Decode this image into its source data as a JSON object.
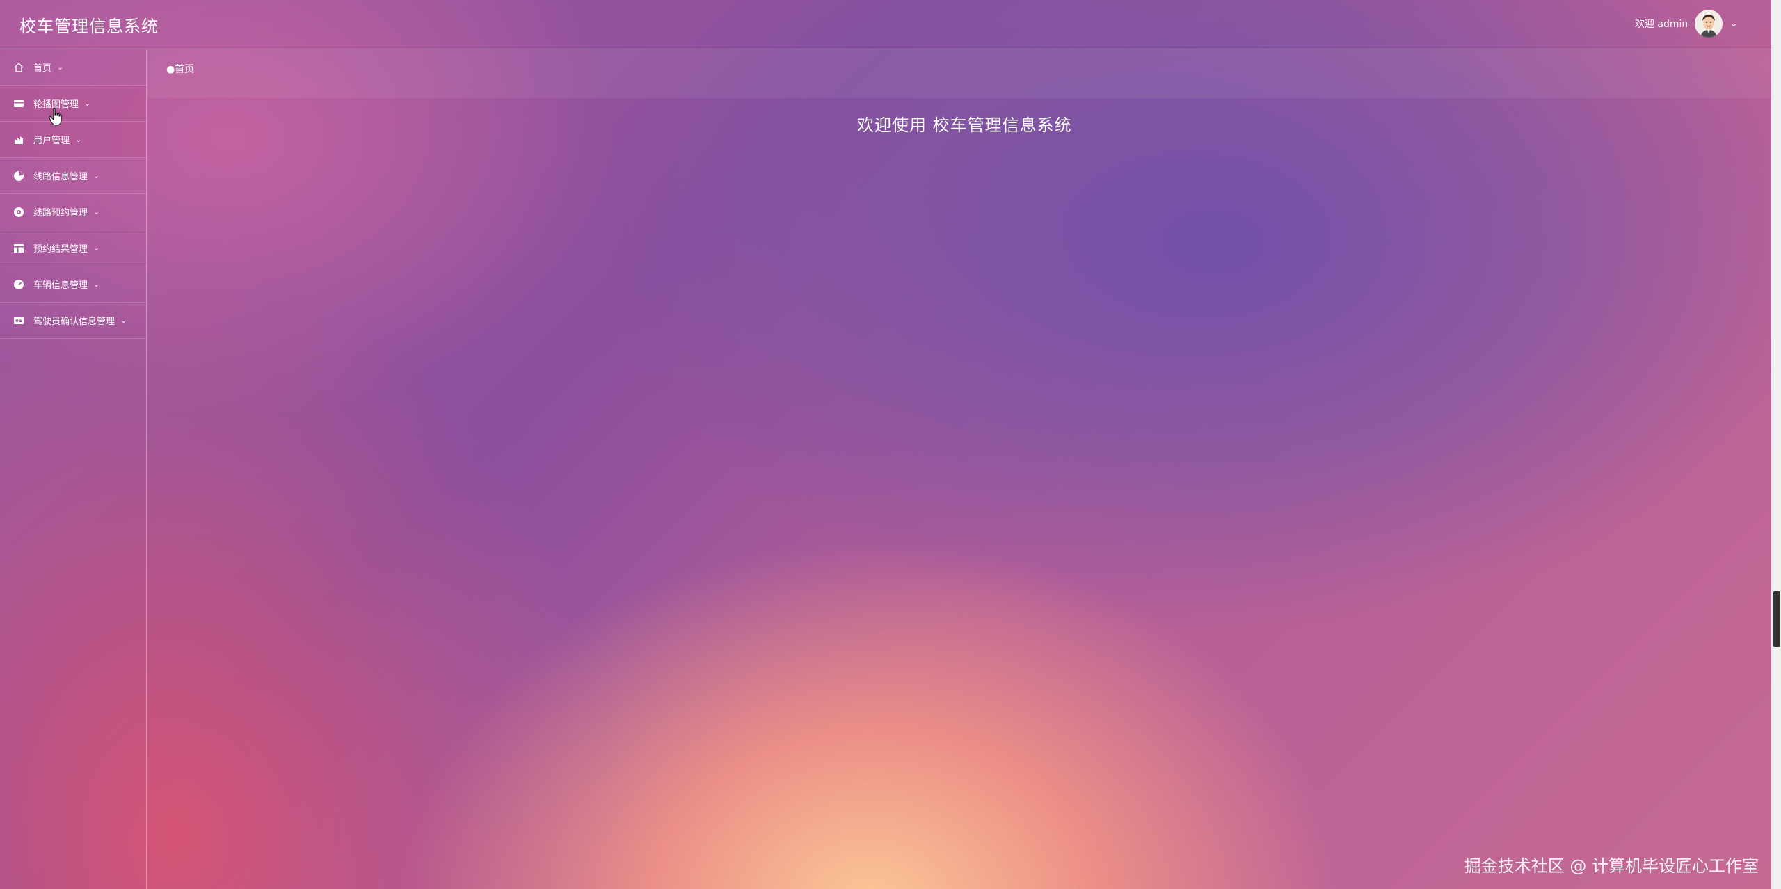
{
  "header": {
    "app_title": "校车管理信息系统",
    "welcome_user": "欢迎 admin"
  },
  "sidebar": {
    "items": [
      {
        "label": "首页",
        "icon": "home-icon"
      },
      {
        "label": "轮播图管理",
        "icon": "card-icon"
      },
      {
        "label": "用户管理",
        "icon": "chart-icon"
      },
      {
        "label": "线路信息管理",
        "icon": "pie-icon"
      },
      {
        "label": "线路预约管理",
        "icon": "target-icon"
      },
      {
        "label": "预约结果管理",
        "icon": "table-icon"
      },
      {
        "label": "车辆信息管理",
        "icon": "gauge-icon"
      },
      {
        "label": "驾驶员确认信息管理",
        "icon": "id-card-icon"
      }
    ]
  },
  "breadcrumb": {
    "current": "首页"
  },
  "main": {
    "welcome_text": "欢迎使用 校车管理信息系统"
  },
  "watermark": "掘金技术社区 @ 计算机毕设匠心工作室"
}
